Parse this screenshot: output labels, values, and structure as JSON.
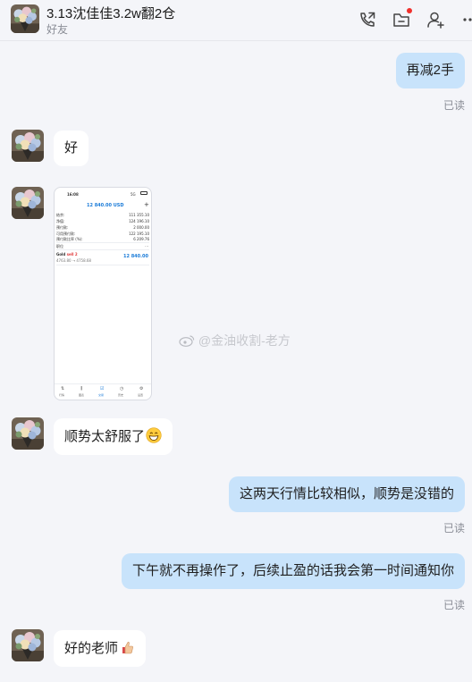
{
  "header": {
    "title": "3.13沈佳佳3.2w翻2仓",
    "subtitle": "好友",
    "icons": [
      "phone-call-icon",
      "folder-icon",
      "add-friend-icon",
      "more-icon"
    ],
    "notification_color": "#f0302c"
  },
  "messages": [
    {
      "id": "m1",
      "direction": "outgoing",
      "text": "再减2手",
      "status": "已读"
    },
    {
      "id": "m2",
      "direction": "incoming",
      "text": "好"
    },
    {
      "id": "m3",
      "direction": "incoming",
      "type": "image"
    },
    {
      "id": "m4",
      "direction": "incoming",
      "text": "顺势太舒服了",
      "emoji": "grinning-face"
    },
    {
      "id": "m5",
      "direction": "outgoing",
      "text": "这两天行情比较相似，顺势是没错的",
      "status": "已读"
    },
    {
      "id": "m6",
      "direction": "outgoing",
      "text": "下午就不再操作了，后续止盈的话我会第一时间通知你",
      "status": "已读"
    },
    {
      "id": "m7",
      "direction": "incoming",
      "text": "好的老师",
      "emoji": "thumbs-up"
    }
  ],
  "screenshot": {
    "time": "16:08",
    "signal": "5G",
    "balance_header": "12 840.00 USD",
    "rows": [
      {
        "label": "结余:",
        "value": "111 355.10"
      },
      {
        "label": "净值:",
        "value": "124 196.10"
      },
      {
        "label": "预付款:",
        "value": "2 000.00"
      },
      {
        "label": "可用预付款:",
        "value": "122 195.10"
      },
      {
        "label": "预付款比率 (%):",
        "value": "6 209.76"
      }
    ],
    "section_label": "职位",
    "section_more": "...",
    "position": {
      "symbol": "Gold",
      "side": "sell 2",
      "prices": "4763.80 → 4758.68",
      "profit": "12 840.00"
    },
    "tabs": [
      "行情",
      "图表",
      "交易",
      "历史",
      "设置"
    ]
  },
  "watermark": "@金油收割-老方",
  "colors": {
    "bubble_out": "#c8e3fb",
    "bubble_in": "#ffffff",
    "background": "#f4f5f9",
    "accent_blue": "#1a7bd8",
    "loss_red": "#e0393a"
  }
}
